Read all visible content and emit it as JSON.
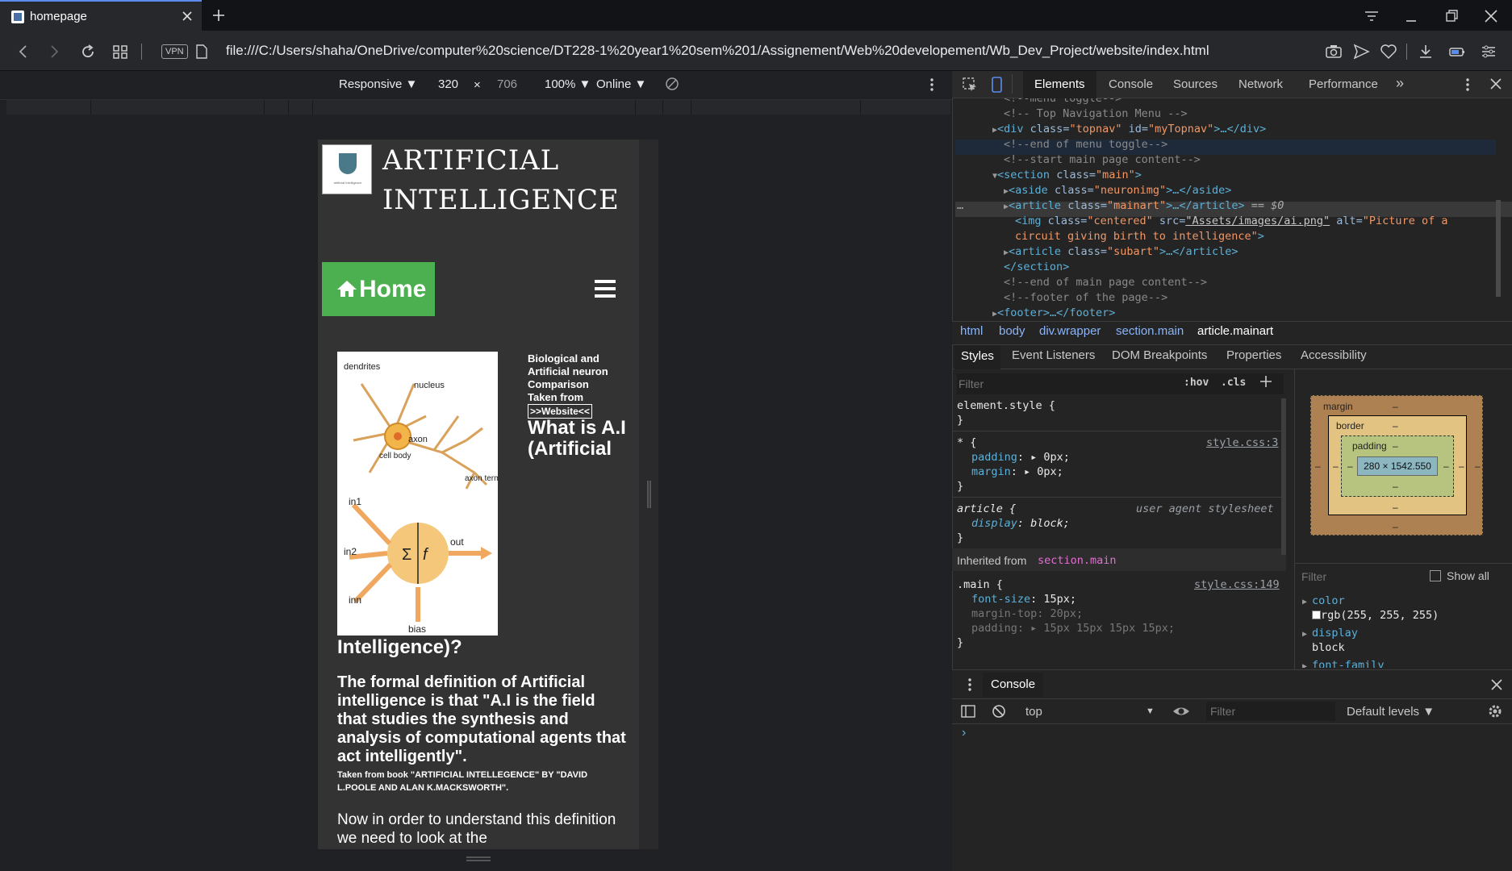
{
  "tab": {
    "title": "homepage"
  },
  "address": {
    "url": "file:///C:/Users/shaha/OneDrive/computer%20science/DT228-1%20year1%20sem%201/Assignement/Web%20developement/Wb_Dev_Project/website/index.html",
    "vpn_label": "VPN"
  },
  "device_toolbar": {
    "mode": "Responsive ▼",
    "width": "320",
    "times": "×",
    "height": "706",
    "zoom": "100% ▼",
    "network": "Online ▼"
  },
  "site": {
    "title_line1": "ARTIFICIAL",
    "title_line2": "INTELLIGENCE",
    "logo_caption": "artificial intelligence",
    "home_label": "Home",
    "caption_text": "Biological and Artificial neuron Comparison Taken from",
    "caption_link": ">>Website<<",
    "heading_line1": "What is A.I",
    "heading_line2": "(Artificial",
    "heading_line3": "Intelligence)?",
    "para1": "The formal definition of Artificial intelligence is that \"A.I is the field that studies the synthesis and analysis of computational agents that act intelligently\".",
    "para2": "Taken from book \"ARTIFICIAL INTELLEGENCE\" BY \"DAVID L.POOLE AND ALAN K.MACKSWORTH\".",
    "para3": "Now in order to understand this definition we need to look at the",
    "neuron_labels": {
      "dendrites": "dendrites",
      "nucleus": "nucleus",
      "cell_body": "cell body",
      "axon": "axon",
      "axon_terminals": "axon terminals",
      "in1": "in1",
      "in2": "in2",
      "inn": "inn",
      "out": "out",
      "bias": "bias",
      "sigma": "Σ",
      "f": "f"
    }
  },
  "devtools": {
    "tabs": {
      "elements": "Elements",
      "console": "Console",
      "sources": "Sources",
      "network": "Network",
      "performance": "Performance",
      "more": "»"
    },
    "dom": {
      "l0": "<!--menu toggle-->",
      "l1": "<!-- Top Navigation Menu -->",
      "l2_tag": "<div",
      "l2_a1": " class=",
      "l2_v1": "\"topnav\"",
      "l2_a2": " id=",
      "l2_v2": "\"myTopnav\"",
      "l2_end": ">…</div>",
      "l3": "<!--end of menu toggle-->",
      "l4": "<!--start main page content-->",
      "l5_tag": "<section",
      "l5_a": " class=",
      "l5_v": "\"main\"",
      "l5_end": ">",
      "l6_tag": "<aside",
      "l6_a": " class=",
      "l6_v": "\"neuronimg\"",
      "l6_end": ">…</aside>",
      "l7_tag": "<article",
      "l7_a": " class=",
      "l7_v": "\"mainart\"",
      "l7_end": ">…</article>",
      "l7_eq": " == $0",
      "l8_tag": "<img",
      "l8_a1": " class=",
      "l8_v1": "\"centered\"",
      "l8_a2": " src=",
      "l8_v2": "\"Assets/images/ai.png\"",
      "l8_a3": " alt=",
      "l8_v3": "\"Picture of a",
      "l9_v": "circuit giving birth to intelligence\"",
      "l9_end": ">",
      "l10_tag": "<article",
      "l10_a": " class=",
      "l10_v": "\"subart\"",
      "l10_end": ">…</article>",
      "l11": "</section>",
      "l12": "<!--end of main page content-->",
      "l13": "<!--footer of the page-->",
      "l14": "<footer>…</footer>",
      "dots": "…"
    },
    "breadcrumbs": [
      "html",
      "body",
      "div.wrapper",
      "section.main",
      "article.mainart"
    ],
    "subtabs": {
      "styles": "Styles",
      "listeners": "Event Listeners",
      "dom_bp": "DOM Breakpoints",
      "properties": "Properties",
      "accessibility": "Accessibility"
    },
    "styles": {
      "filter_placeholder": "Filter",
      "hov": ":hov",
      "cls": ".cls",
      "element_style": "element.style {",
      "close": "}",
      "star_sel": "* {",
      "star_src": "style.css:3",
      "padding_prop": "padding",
      "padding_val": "0px;",
      "margin_prop": "margin",
      "margin_val": "0px;",
      "article_sel": "article {",
      "article_src": "user agent stylesheet",
      "display_prop": "display",
      "display_val": "block;",
      "inherited": "Inherited from",
      "inherited_sel": "section.main",
      "main_sel": ".main {",
      "main_src": "style.css:149",
      "fs_prop": "font-size",
      "fs_val": "15px;",
      "mt_prop": "margin-top",
      "mt_val": "20px;",
      "pad_prop": "padding",
      "pad_val": "15px 15px 15px 15px;"
    },
    "boxmodel": {
      "margin": "margin",
      "border": "border",
      "padding": "padding",
      "content": "280 × 1542.550",
      "dash": "–"
    },
    "computed": {
      "filter_placeholder": "Filter",
      "show_all": "Show all",
      "color_prop": "color",
      "color_val": "rgb(255, 255, 255)",
      "display_prop": "display",
      "display_val": "block",
      "ff_prop": "font-family"
    },
    "console": {
      "tab": "Console",
      "context": "top",
      "filter_placeholder": "Filter",
      "levels": "Default levels ▼",
      "prompt": "›"
    }
  },
  "colors": {
    "accent_green": "#4caf50",
    "devtools_bg": "#242424",
    "tag_blue": "#5db0d7"
  }
}
